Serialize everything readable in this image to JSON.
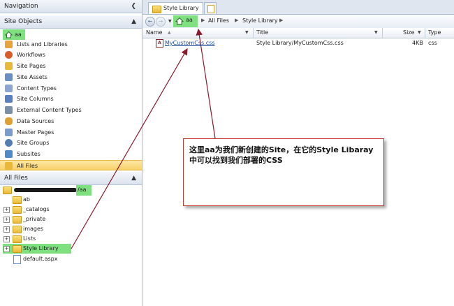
{
  "nav": {
    "title": "Navigation",
    "site_objects_title": "Site Objects",
    "site_name": "aa",
    "items": [
      {
        "label": "Lists and Libraries",
        "icon": "lists-icon",
        "color": "#e7a43a"
      },
      {
        "label": "Workflows",
        "icon": "workflow-icon",
        "color": "#d95b2a"
      },
      {
        "label": "Site Pages",
        "icon": "page-icon",
        "color": "#e9b838"
      },
      {
        "label": "Site Assets",
        "icon": "assets-icon",
        "color": "#6a8fc7"
      },
      {
        "label": "Content Types",
        "icon": "content-type-icon",
        "color": "#8aa5cf"
      },
      {
        "label": "Site Columns",
        "icon": "columns-icon",
        "color": "#5a7fbf"
      },
      {
        "label": "External Content Types",
        "icon": "external-icon",
        "color": "#7a8fa8"
      },
      {
        "label": "Data Sources",
        "icon": "database-icon",
        "color": "#e0a030"
      },
      {
        "label": "Master Pages",
        "icon": "master-page-icon",
        "color": "#7a9ccc"
      },
      {
        "label": "Site Groups",
        "icon": "groups-icon",
        "color": "#557db0"
      },
      {
        "label": "Subsites",
        "icon": "subsites-icon",
        "color": "#4f8ac9"
      },
      {
        "label": "All Files",
        "icon": "folder-icon",
        "color": "#e9b838"
      }
    ],
    "all_files_title": "All Files"
  },
  "tree": {
    "root_suffix": "/aa",
    "items": [
      "ab",
      "_catalogs",
      "_private",
      "images",
      "Lists",
      "Style Library",
      "default.aspx"
    ]
  },
  "tabs": {
    "active": "Style Library"
  },
  "breadcrumb": {
    "site": "aa",
    "items": [
      "All Files",
      "Style Library"
    ]
  },
  "columns": {
    "name": "Name",
    "title": "Title",
    "size": "Size",
    "type": "Type"
  },
  "files": [
    {
      "name": "MyCustomCss.css",
      "title": "Style Library/MyCustomCss.css",
      "size": "4KB",
      "type": "css"
    }
  ],
  "callout": {
    "text": "这里aa为我们新创建的Site，在它的Style Libaray中可以找到我们部署的CSS"
  },
  "colors": {
    "highlight": "#7fe07f",
    "arrow": "#8b1a2a",
    "selected": "#f9d06a"
  }
}
